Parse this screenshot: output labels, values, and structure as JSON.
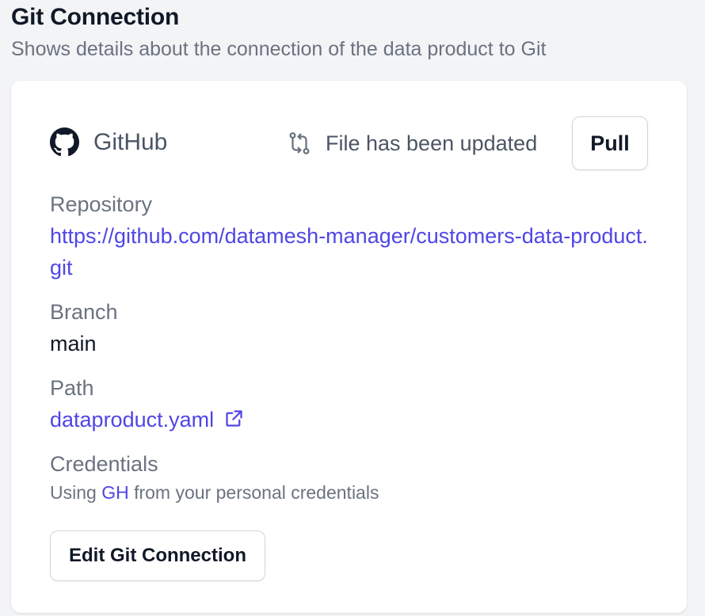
{
  "section": {
    "title": "Git Connection",
    "subtitle": "Shows details about the connection of the data product to Git"
  },
  "provider": {
    "name": "GitHub",
    "icon": "github-icon"
  },
  "status": {
    "text": "File has been updated",
    "icon": "git-pull-request-icon"
  },
  "actions": {
    "pull_label": "Pull",
    "edit_label": "Edit Git Connection"
  },
  "repository": {
    "label": "Repository",
    "url": "https://github.com/datamesh-manager/customers-data-product.git"
  },
  "branch": {
    "label": "Branch",
    "value": "main"
  },
  "path": {
    "label": "Path",
    "value": "dataproduct.yaml",
    "icon": "external-link-icon"
  },
  "credentials": {
    "label": "Credentials",
    "prefix": "Using ",
    "name": "GH",
    "suffix": " from your personal credentials"
  },
  "colors": {
    "link": "#4f46e5",
    "muted": "#6b7280",
    "text": "#111827",
    "background": "#f3f4f6"
  }
}
